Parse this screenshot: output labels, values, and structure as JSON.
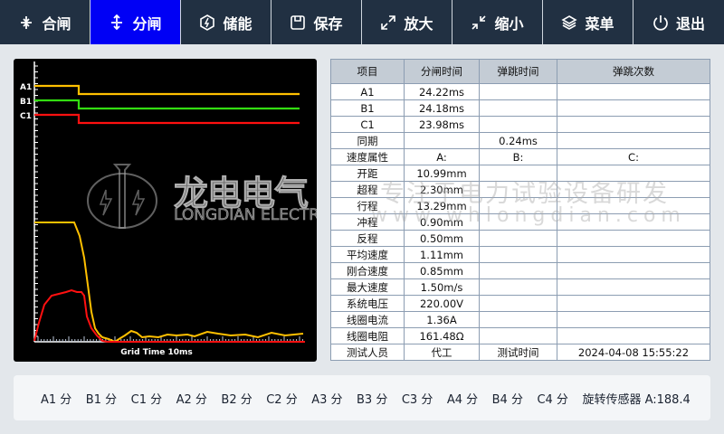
{
  "toolbar": [
    {
      "label": "合闸",
      "icon": "close-arrows-icon"
    },
    {
      "label": "分闸",
      "icon": "open-arrows-icon",
      "active": true
    },
    {
      "label": "储能",
      "icon": "energy-hexagon-icon"
    },
    {
      "label": "保存",
      "icon": "save-icon"
    },
    {
      "label": "放大",
      "icon": "expand-icon"
    },
    {
      "label": "缩小",
      "icon": "shrink-icon"
    },
    {
      "label": "菜单",
      "icon": "layers-icon"
    },
    {
      "label": "退出",
      "icon": "power-icon"
    }
  ],
  "chart": {
    "channel_labels": [
      "A1",
      "B1",
      "C1"
    ],
    "xlabel": "Grid Time 10ms",
    "colors": {
      "A1": "#ffc000",
      "B1": "#33dd11",
      "C1": "#ff1010",
      "travel": "#ffc000",
      "current": "#ff1010"
    }
  },
  "watermark": {
    "brand_cn": "龙电电气",
    "brand_en": "LONGDIAN ELECTRIC",
    "slogan": "专注于电力试验设备研发",
    "url": "www.whlongdian.com"
  },
  "table": {
    "headers": [
      "项目",
      "分闸时间",
      "弹跳时间",
      "弹跳次数"
    ],
    "rows": [
      [
        "A1",
        "24.22ms",
        "",
        ""
      ],
      [
        "B1",
        "24.18ms",
        "",
        ""
      ],
      [
        "C1",
        "23.98ms",
        "",
        ""
      ],
      [
        "同期",
        "",
        "0.24ms",
        ""
      ],
      [
        "速度属性",
        "A:",
        "B:",
        "C:"
      ],
      [
        "开距",
        "10.99mm",
        "",
        ""
      ],
      [
        "超程",
        "2.30mm",
        "",
        ""
      ],
      [
        "行程",
        "13.29mm",
        "",
        ""
      ],
      [
        "冲程",
        "0.90mm",
        "",
        ""
      ],
      [
        "反程",
        "0.50mm",
        "",
        ""
      ],
      [
        "平均速度",
        "1.11mm",
        "",
        ""
      ],
      [
        "刚合速度",
        "0.85mm",
        "",
        ""
      ],
      [
        "最大速度",
        "1.50m/s",
        "",
        ""
      ],
      [
        "系统电压",
        "220.00V",
        "",
        ""
      ],
      [
        "线圈电流",
        "1.36A",
        "",
        ""
      ],
      [
        "线圈电阻",
        "161.48Ω",
        "",
        ""
      ],
      [
        "测试人员",
        "代工",
        "测试时间",
        "2024-04-08 15:55:22"
      ]
    ]
  },
  "footer": [
    "A1 分",
    "B1 分",
    "C1 分",
    "A2 分",
    "B2 分",
    "C2 分",
    "A3 分",
    "B3 分",
    "C3 分",
    "A4 分",
    "B4 分",
    "C4 分",
    "旋转传感器 A:188.4"
  ]
}
